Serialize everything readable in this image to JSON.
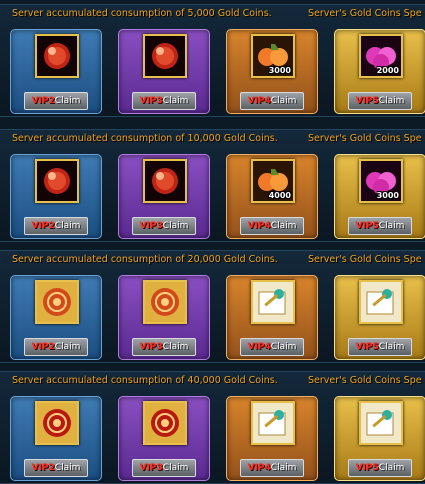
{
  "sections": [
    {
      "title": "Server accumulated consumption of 5,000 Gold Coins.",
      "extra": "Server's Gold Coins Spe",
      "cards": [
        {
          "vip": "VIP2",
          "claim": "Claim",
          "color": "blue",
          "icon": "red-orb-icon",
          "count": ""
        },
        {
          "vip": "VIP3",
          "claim": "Claim",
          "color": "purple",
          "icon": "red-orb-icon",
          "count": ""
        },
        {
          "vip": "VIP4",
          "claim": "Claim",
          "color": "orange",
          "icon": "peach-icon",
          "count": "3000"
        },
        {
          "vip": "VIP5",
          "claim": "Claim",
          "color": "gold",
          "icon": "peach-icon",
          "count": "2000"
        }
      ]
    },
    {
      "title": "Server accumulated consumption of 10,000 Gold Coins.",
      "extra": "Server's Gold Coins Spe",
      "cards": [
        {
          "vip": "VIP2",
          "claim": "Claim",
          "color": "blue",
          "icon": "red-orb-icon",
          "count": ""
        },
        {
          "vip": "VIP3",
          "claim": "Claim",
          "color": "purple",
          "icon": "red-orb-icon",
          "count": ""
        },
        {
          "vip": "VIP4",
          "claim": "Claim",
          "color": "orange",
          "icon": "peach-icon",
          "count": "4000"
        },
        {
          "vip": "VIP5",
          "claim": "Claim",
          "color": "gold",
          "icon": "peach-icon",
          "count": "3000"
        }
      ]
    },
    {
      "title": "Server accumulated consumption of 20,000 Gold Coins.",
      "extra": "Server's Gold Coins Spe",
      "cards": [
        {
          "vip": "VIP2",
          "claim": "Claim",
          "color": "blue",
          "icon": "spiral-scroll-icon",
          "count": ""
        },
        {
          "vip": "VIP3",
          "claim": "Claim",
          "color": "purple",
          "icon": "spiral-scroll-icon",
          "count": ""
        },
        {
          "vip": "VIP4",
          "claim": "Claim",
          "color": "orange",
          "icon": "key-scroll-icon",
          "count": ""
        },
        {
          "vip": "VIP5",
          "claim": "Claim",
          "color": "gold",
          "icon": "key-scroll-icon",
          "count": ""
        }
      ]
    },
    {
      "title": "Server accumulated consumption of 40,000 Gold Coins.",
      "extra": "Server's Gold Coins Spe",
      "cards": [
        {
          "vip": "VIP2",
          "claim": "Claim",
          "color": "blue",
          "icon": "spiral-scroll-icon",
          "count": ""
        },
        {
          "vip": "VIP3",
          "claim": "Claim",
          "color": "purple",
          "icon": "spiral-scroll-icon",
          "count": ""
        },
        {
          "vip": "VIP4",
          "claim": "Claim",
          "color": "orange",
          "icon": "key-scroll-icon",
          "count": ""
        },
        {
          "vip": "VIP5",
          "claim": "Claim",
          "color": "gold",
          "icon": "key-scroll-icon",
          "count": ""
        }
      ]
    }
  ]
}
